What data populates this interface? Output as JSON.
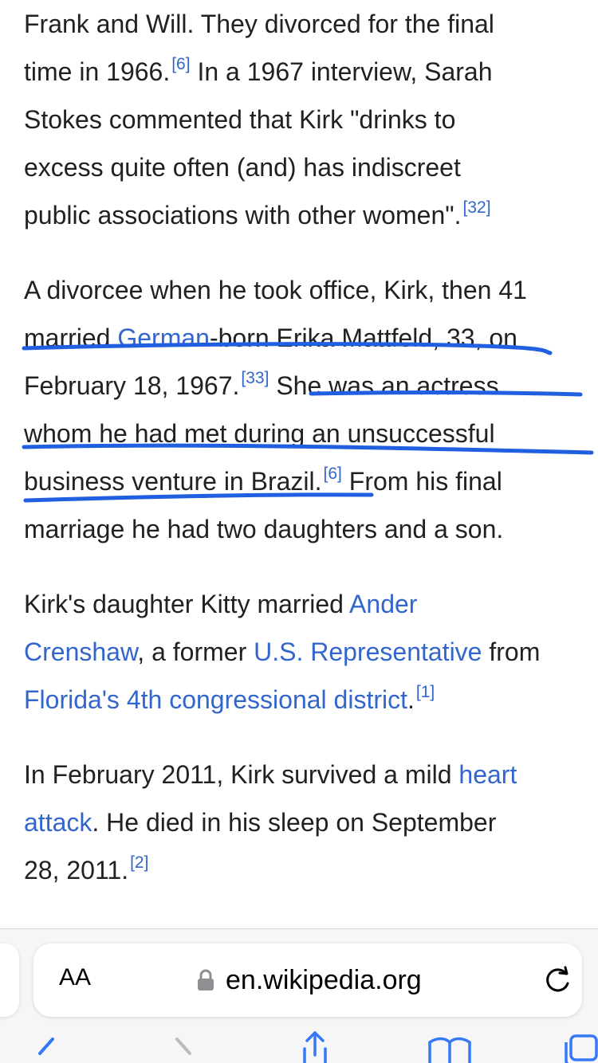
{
  "article": {
    "p1": {
      "l1": "Frank and Will. They divorced for the final",
      "l2a": "time in 1966.",
      "ref1": "[6]",
      "l2b": " In a 1967 interview, Sarah",
      "l3": "Stokes commented that Kirk \"drinks to",
      "l4": "excess quite often (and) has indiscreet",
      "l5a": "public associations with other women\".",
      "ref2": "[32]"
    },
    "p2": {
      "l1": "A divorcee when he took office, Kirk, then 41",
      "l2a": "married ",
      "link_german": "German",
      "l2b": "-born Erika Mattfeld, 33, on",
      "l3a": "February 18, 1967.",
      "ref1": "[33]",
      "l3b": " She was an actress",
      "l4": "whom he had met during an unsuccessful",
      "l5a": "business venture in Brazil.",
      "ref2": "[6]",
      "l5b": " From his final",
      "l6": "marriage he had two daughters and a son."
    },
    "p3": {
      "l1a": "Kirk's daughter Kitty married ",
      "link_ander": "Ander",
      "link_crenshaw": "Crenshaw",
      "l2a": ", a former ",
      "link_usrep": "U.S. Representative",
      "l2b": " from",
      "link_district": "Florida's 4th congressional district",
      "l3b": ".",
      "ref1": "[1]"
    },
    "p4": {
      "l1a": "In February 2011, Kirk survived a mild ",
      "link_heart": "heart",
      "link_attack": "attack",
      "l2b": ". He died in his sleep on September",
      "l3a": "28, 2011.",
      "ref1": "[2]"
    }
  },
  "browser": {
    "text_size_button": "AA",
    "url": "en.wikipedia.org",
    "icons": [
      "lock-icon",
      "reload-icon",
      "back-icon",
      "forward-icon",
      "share-icon",
      "bookmarks-icon",
      "tabs-icon"
    ]
  },
  "colors": {
    "text": "#202122",
    "link": "#3366cc",
    "annotation": "#1f5fe0"
  }
}
